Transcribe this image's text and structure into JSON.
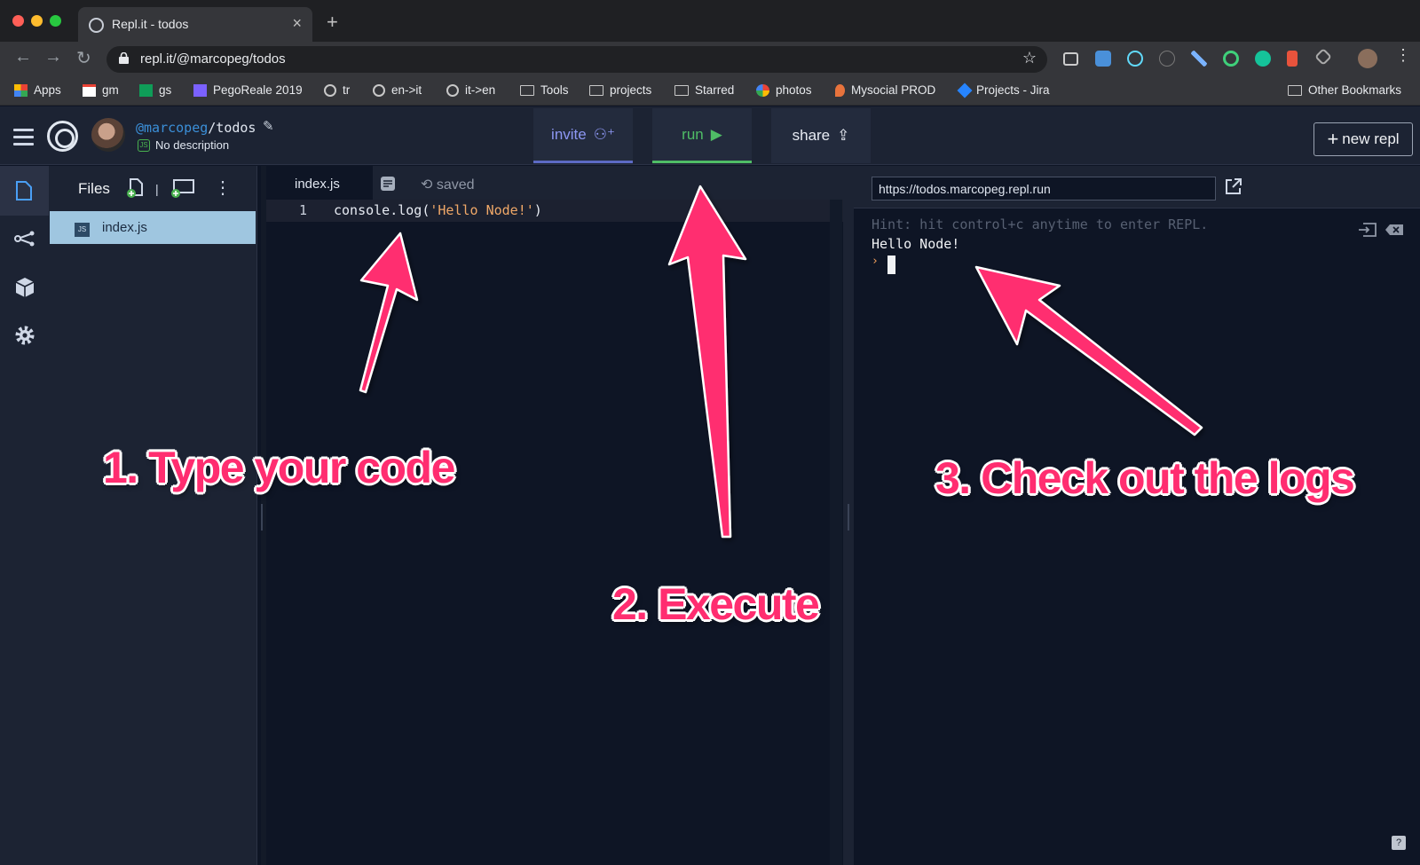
{
  "browser": {
    "tab_title": "Repl.it - todos",
    "url": "repl.it/@marcopeg/todos",
    "bookmarks": [
      "Apps",
      "gm",
      "gs",
      "PegoReale 2019",
      "tr",
      "en->it",
      "it->en",
      "Tools",
      "projects",
      "Starred",
      "photos",
      "Mysocial PROD",
      "Projects - Jira"
    ],
    "other_bookmarks": "Other Bookmarks"
  },
  "header": {
    "user": "@marcopeg",
    "repl_name": "/todos",
    "description": "No description",
    "invite_label": "invite",
    "run_label": "run",
    "share_label": "share",
    "new_repl_label": "new repl"
  },
  "files": {
    "title": "Files",
    "items": [
      "index.js"
    ]
  },
  "editor": {
    "tab": "index.js",
    "status": "saved",
    "line_number": "1",
    "code_prefix": "console.log(",
    "code_string": "'Hello Node!'",
    "code_suffix": ")"
  },
  "console": {
    "url": "https://todos.marcopeg.repl.run",
    "hint": "Hint: hit control+c anytime to enter REPL.",
    "output": "Hello Node!",
    "prompt": "›"
  },
  "annotations": {
    "step1": "1. Type your code",
    "step2": "2. Execute",
    "step3": "3. Check out the logs"
  },
  "help_label": "?"
}
